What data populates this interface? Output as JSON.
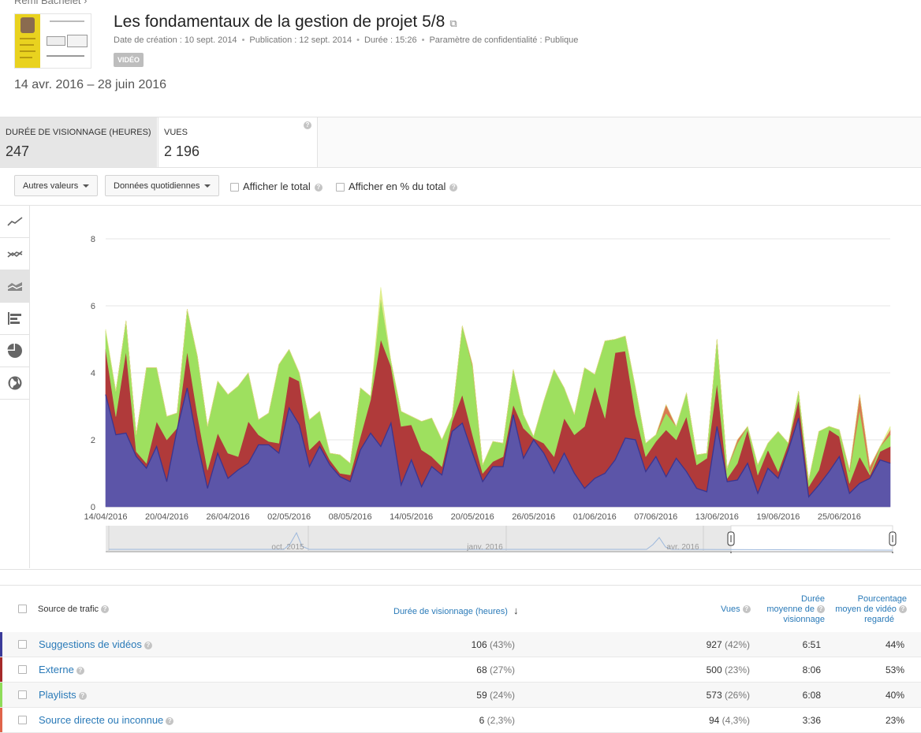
{
  "header": {
    "channel": "Rémi Bachelet",
    "title": "Les fondamentaux de la gestion de projet 5/8",
    "meta": [
      "Date de création : 10 sept. 2014",
      "Publication : 12 sept. 2014",
      "Durée : 15:26",
      "Paramètre de confidentialité : Publique"
    ],
    "badge": "VIDÉO",
    "date_range": "14 avr. 2016 – 28 juin 2016"
  },
  "metrics": [
    {
      "label": "Durée de visionnage (heures)",
      "value": "247"
    },
    {
      "label": "Vues",
      "value": "2 196"
    }
  ],
  "controls": {
    "other_values": "Autres valeurs",
    "daily_data": "Données quotidiennes",
    "show_total": "Afficher le total",
    "show_pct": "Afficher en % du total"
  },
  "sidebar_icons": [
    "line-chart-icon",
    "multi-line-icon",
    "stacked-area-icon",
    "bar-chart-icon",
    "pie-chart-icon",
    "globe-icon"
  ],
  "chart_data": {
    "type": "area",
    "stacked": true,
    "y_ticks": [
      "0",
      "2",
      "4",
      "6",
      "8"
    ],
    "ylim": [
      0,
      8
    ],
    "x_tick_labels": [
      "14/04/2016",
      "20/04/2016",
      "26/04/2016",
      "02/05/2016",
      "08/05/2016",
      "14/05/2016",
      "20/05/2016",
      "26/05/2016",
      "01/06/2016",
      "07/06/2016",
      "13/06/2016",
      "19/06/2016",
      "25/06/2016"
    ],
    "grid": true,
    "series": [
      {
        "color": "#5c55a8",
        "values": [
          3.35,
          2.15,
          2.2,
          1.5,
          1.15,
          1.8,
          0.75,
          2.3,
          3.55,
          1.9,
          0.55,
          1.6,
          0.85,
          1.1,
          1.3,
          1.85,
          1.85,
          1.6,
          2.95,
          2.45,
          1.2,
          1.8,
          1.25,
          0.9,
          0.75,
          1.7,
          2.2,
          1.8,
          2.5,
          0.65,
          1.4,
          0.6,
          1.2,
          0.95,
          2.25,
          2.5,
          1.6,
          0.75,
          1.2,
          1.2,
          2.75,
          1.45,
          2.0,
          1.6,
          1.0,
          1.6,
          1.0,
          0.55,
          0.85,
          1.0,
          1.4,
          2.05,
          2.0,
          1.05,
          1.5,
          0.9,
          1.45,
          1.05,
          0.55,
          0.45,
          2.4,
          0.75,
          0.8,
          1.3,
          0.4,
          1.15,
          0.85,
          1.7,
          2.65,
          0.3,
          0.65,
          1.05,
          1.5,
          0.4,
          0.7,
          0.85,
          1.4,
          1.3
        ]
      },
      {
        "color": "#b03a3a",
        "values": [
          1.35,
          0.55,
          2.45,
          0.15,
          0.15,
          0.75,
          1.25,
          0.05,
          1.1,
          0.85,
          0.55,
          0.6,
          0.75,
          0.4,
          1.25,
          0.3,
          0.1,
          0.3,
          0.95,
          1.3,
          0.5,
          0.2,
          0.15,
          0.1,
          0.2,
          0.4,
          1.0,
          3.2,
          1.7,
          1.75,
          1.05,
          1.1,
          0.3,
          0.25,
          0.3,
          0.85,
          0.55,
          0.25,
          0.15,
          0.3,
          0.3,
          0.9,
          0.05,
          0.3,
          0.5,
          1.05,
          1.15,
          1.85,
          2.75,
          1.65,
          3.2,
          2.6,
          0.75,
          0.45,
          0.45,
          1.4,
          0.55,
          1.65,
          0.7,
          1.0,
          1.3,
          0.1,
          0.5,
          1.0,
          0.55,
          0.55,
          0.2,
          0.2,
          0.55,
          0.3,
          0.45,
          1.25,
          0.6,
          0.3,
          0.8,
          0.1,
          0.25,
          0.5
        ]
      },
      {
        "color": "#9ee05f",
        "values": [
          0.55,
          0.75,
          0.9,
          0.5,
          2.85,
          1.6,
          0.7,
          0.45,
          1.25,
          1.75,
          1.3,
          1.55,
          1.75,
          2.1,
          1.45,
          0.45,
          0.85,
          2.35,
          0.8,
          0.25,
          0.9,
          0.85,
          0.2,
          0.55,
          0.35,
          1.45,
          0.1,
          1.25,
          0.15,
          0.45,
          0.25,
          0.85,
          1.15,
          0.8,
          0.15,
          2.05,
          2.05,
          0.25,
          0.6,
          0.4,
          1.05,
          0.4,
          0.05,
          1.25,
          2.6,
          0.9,
          0.6,
          1.75,
          0.35,
          2.3,
          0.4,
          0.45,
          0.8,
          0.4,
          0.2,
          0.5,
          0.4,
          0.7,
          0.3,
          0.15,
          1.3,
          0.3,
          0.6,
          0.1,
          0.3,
          0.2,
          1.2,
          0.0,
          0.25,
          0.2,
          1.15,
          0.1,
          0.2,
          0.35,
          1.4,
          0.05,
          0.15,
          0.35
        ]
      },
      {
        "color": "#d97a52",
        "values": [
          0.0,
          0.0,
          0.0,
          0.0,
          0.0,
          0.0,
          0.0,
          0.0,
          0.0,
          0.0,
          0.0,
          0.0,
          0.0,
          0.0,
          0.0,
          0.0,
          0.0,
          0.0,
          0.0,
          0.0,
          0.0,
          0.0,
          0.0,
          0.0,
          0.0,
          0.0,
          0.0,
          0.0,
          0.0,
          0.0,
          0.0,
          0.0,
          0.0,
          0.0,
          0.0,
          0.0,
          0.05,
          0.0,
          0.0,
          0.0,
          0.0,
          0.0,
          0.0,
          0.0,
          0.0,
          0.0,
          0.0,
          0.0,
          0.0,
          0.0,
          0.0,
          0.0,
          0.0,
          0.0,
          0.0,
          0.25,
          0.0,
          0.0,
          0.0,
          0.0,
          0.0,
          0.0,
          0.1,
          0.0,
          0.0,
          0.0,
          0.0,
          0.0,
          0.0,
          0.0,
          0.0,
          0.0,
          0.0,
          0.05,
          0.45,
          0.2,
          0.0,
          0.15
        ]
      },
      {
        "color": "#dfee8e",
        "values": [
          0.05,
          0.0,
          0.0,
          0.0,
          0.0,
          0.0,
          0.0,
          0.0,
          0.0,
          0.0,
          0.0,
          0.0,
          0.0,
          0.0,
          0.0,
          0.0,
          0.0,
          0.0,
          0.0,
          0.0,
          0.0,
          0.0,
          0.0,
          0.0,
          0.0,
          0.0,
          0.0,
          0.3,
          0.0,
          0.0,
          0.0,
          0.0,
          0.0,
          0.0,
          0.0,
          0.0,
          0.0,
          0.0,
          0.0,
          0.0,
          0.0,
          0.0,
          0.0,
          0.0,
          0.0,
          0.0,
          0.0,
          0.0,
          0.0,
          0.0,
          0.0,
          0.0,
          0.0,
          0.0,
          0.0,
          0.0,
          0.0,
          0.0,
          0.0,
          0.0,
          0.0,
          0.0,
          0.0,
          0.0,
          0.0,
          0.0,
          0.0,
          0.0,
          0.0,
          0.0,
          0.0,
          0.0,
          0.0,
          0.0,
          0.0,
          0.0,
          0.0,
          0.1
        ]
      }
    ],
    "navigator_labels": [
      "oct. 2015",
      "janv. 2016",
      "avr. 2016"
    ]
  },
  "table": {
    "headers": {
      "source": "Source de trafic",
      "watch_time": "Durée de visionnage (heures)",
      "views": "Vues",
      "avg_duration": [
        "Durée",
        "moyenne de",
        "visionnage"
      ],
      "avg_pct": [
        "Pourcentage",
        "moyen de vidéo",
        "regardé"
      ]
    },
    "rows": [
      {
        "source": "Suggestions de vidéos",
        "color": "#3b3b9a",
        "watch": "106",
        "watch_pct": "(43%)",
        "views": "927",
        "views_pct": "(42%)",
        "avg": "6:51",
        "pct": "44%"
      },
      {
        "source": "Externe",
        "color": "#a52a2a",
        "watch": "68",
        "watch_pct": "(27%)",
        "views": "500",
        "views_pct": "(23%)",
        "avg": "8:06",
        "pct": "53%"
      },
      {
        "source": "Playlists",
        "color": "#8fdc5a",
        "watch": "59",
        "watch_pct": "(24%)",
        "views": "573",
        "views_pct": "(26%)",
        "avg": "6:08",
        "pct": "40%"
      },
      {
        "source": "Source directe ou inconnue",
        "color": "#e0644a",
        "watch": "6",
        "watch_pct": "(2,3%)",
        "views": "94",
        "views_pct": "(4,3%)",
        "avg": "3:36",
        "pct": "23%"
      }
    ]
  }
}
